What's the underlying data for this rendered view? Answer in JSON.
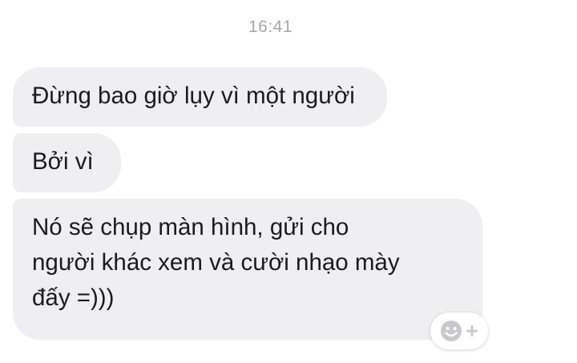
{
  "thread": {
    "timestamp": "16:41",
    "messages": [
      {
        "text": "Đừng bao giờ lụy vì một người"
      },
      {
        "text": "Bởi vì"
      },
      {
        "text": "Nó sẽ chụp màn hình, gửi cho\nngười khác xem và cười nhạo mày\nđấy =)))"
      }
    ]
  },
  "reaction_button": {
    "icon": "smiley-plus-icon"
  }
}
